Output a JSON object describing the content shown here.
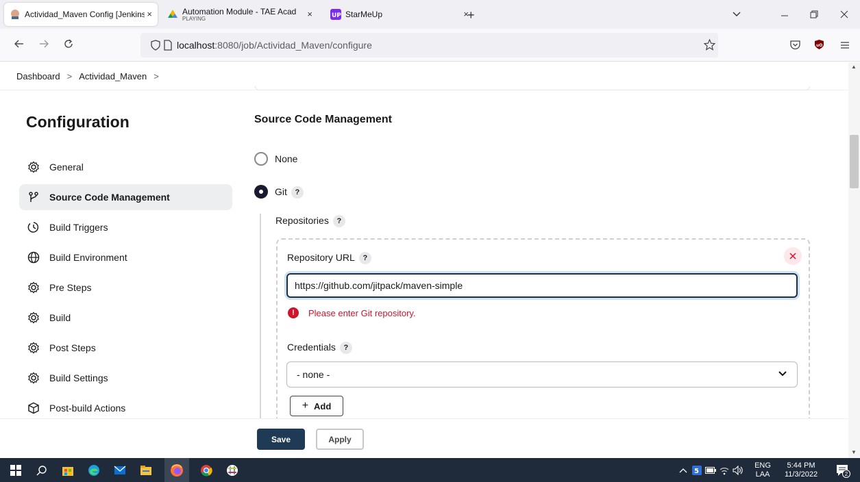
{
  "browser": {
    "tabs": [
      {
        "title": "Actividad_Maven Config [Jenkins]",
        "close": "×",
        "active": true
      },
      {
        "title": "Automation Module - TAE Acad",
        "subtitle": "PLAYING",
        "close": "×",
        "active": false
      },
      {
        "title": "StarMeUp",
        "close": "×",
        "active": false
      }
    ],
    "new_tab": "+",
    "url_host": "localhost",
    "url_path": ":8080/job/Actividad_Maven/configure"
  },
  "breadcrumb": {
    "items": [
      "Dashboard",
      "Actividad_Maven"
    ],
    "separator": ">"
  },
  "sidebar": {
    "title": "Configuration",
    "items": [
      {
        "label": "General",
        "icon": "gear-icon"
      },
      {
        "label": "Source Code Management",
        "icon": "branch-icon",
        "active": true
      },
      {
        "label": "Build Triggers",
        "icon": "clock-icon"
      },
      {
        "label": "Build Environment",
        "icon": "globe-icon"
      },
      {
        "label": "Pre Steps",
        "icon": "gear-icon"
      },
      {
        "label": "Build",
        "icon": "gear-icon"
      },
      {
        "label": "Post Steps",
        "icon": "gear-icon"
      },
      {
        "label": "Build Settings",
        "icon": "gear-icon"
      },
      {
        "label": "Post-build Actions",
        "icon": "package-icon"
      }
    ]
  },
  "main": {
    "section_title": "Source Code Management",
    "radio_none": "None",
    "radio_git": "Git",
    "help": "?",
    "repositories_label": "Repositories",
    "repo_url_label": "Repository URL",
    "repo_url_value": "https://github.com/jitpack/maven-simple",
    "error_text": "Please enter Git repository.",
    "error_icon": "!",
    "credentials_label": "Credentials",
    "credentials_value": "- none -",
    "add_label": "Add",
    "save_label": "Save",
    "apply_label": "Apply"
  },
  "taskbar": {
    "lang_top": "ENG",
    "lang_bottom": "LAA",
    "time": "5:44 PM",
    "date": "11/3/2022",
    "notification_count": "2"
  }
}
